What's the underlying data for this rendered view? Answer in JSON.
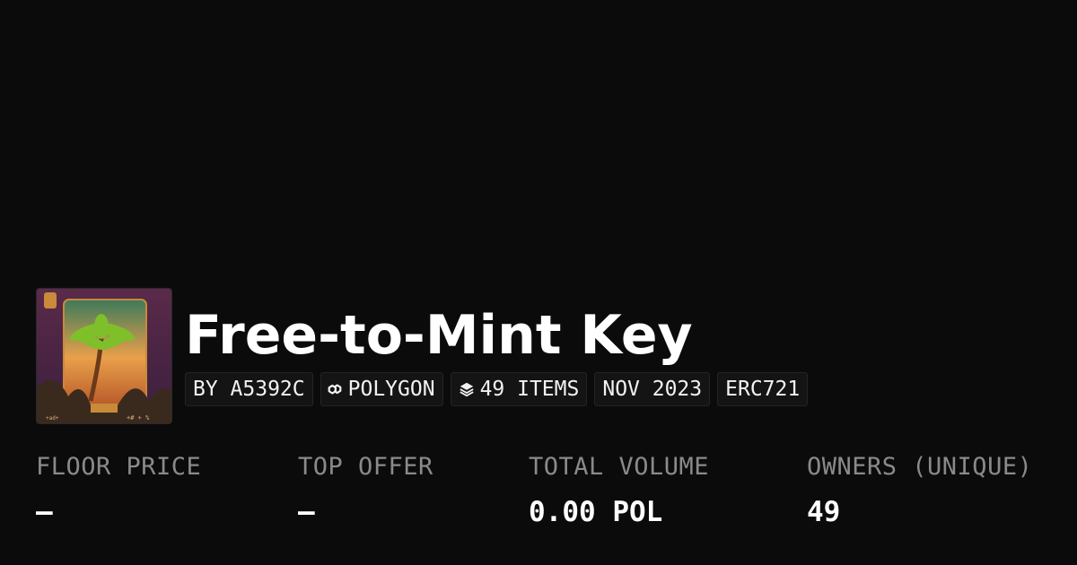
{
  "collection": {
    "title": "Free-to-Mint Key",
    "image_icon": "palm-tree-key-art"
  },
  "chips": [
    {
      "label": "BY A5392C",
      "icon": ""
    },
    {
      "label": "POLYGON",
      "icon": "polygon-chain-icon"
    },
    {
      "label": "49 ITEMS",
      "icon": "layers-icon"
    },
    {
      "label": "NOV 2023",
      "icon": ""
    },
    {
      "label": "ERC721",
      "icon": ""
    }
  ],
  "stats": [
    {
      "label": "FLOOR PRICE",
      "value": "–"
    },
    {
      "label": "TOP OFFER",
      "value": "–"
    },
    {
      "label": "TOTAL VOLUME",
      "value": "0.00 POL"
    },
    {
      "label": "OWNERS (UNIQUE)",
      "value": "49"
    }
  ],
  "colors": {
    "background": "#0b0b0b",
    "label": "#8a8a8a",
    "chip_bg": "#141414"
  }
}
